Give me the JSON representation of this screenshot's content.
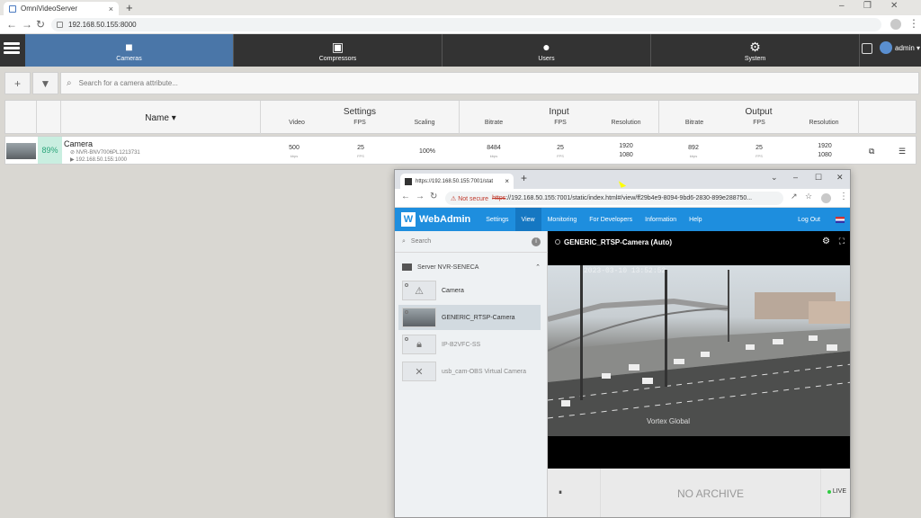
{
  "browser": {
    "tab_title": "OmniVideoServer",
    "tab_close": "×",
    "new_tab": "+",
    "address": "192.168.50.155:8000",
    "min": "–",
    "max": "❐",
    "close": "✕",
    "back": "←",
    "forward": "→",
    "reload": "↻",
    "menu": "⋮"
  },
  "nav": {
    "tabs": [
      "Cameras",
      "Compressors",
      "Users",
      "System"
    ],
    "user": "admin ▾"
  },
  "toolbar": {
    "add": "+",
    "filter": "▼",
    "search_placeholder": "Search for a camera attribute..."
  },
  "table": {
    "name_header": "Name ▾",
    "groups": [
      "Settings",
      "Input",
      "Output"
    ],
    "settings_cols": [
      "Video",
      "FPS",
      "Scaling"
    ],
    "input_cols": [
      "Bitrate",
      "FPS",
      "Resolution"
    ],
    "output_cols": [
      "Bitrate",
      "FPS",
      "Resolution"
    ],
    "row": {
      "health": "89%",
      "name": "Camera",
      "sub1": "NVR-BNV7006PL1213731",
      "sub2": "192.168.50.155:1000",
      "video": "500",
      "video_unit": "kbps",
      "fps": "25",
      "fps_unit": "FPS",
      "scaling": "100%",
      "in_bitrate": "8484",
      "in_bitrate_unit": "kbps",
      "in_fps": "25",
      "in_fps_unit": "FPS",
      "in_res_w": "1920",
      "in_res_h": "1080",
      "out_bitrate": "892",
      "out_bitrate_unit": "kbps",
      "out_fps": "25",
      "out_fps_unit": "FPS",
      "out_res_w": "1920",
      "out_res_h": "1080"
    }
  },
  "popup": {
    "tab_title": "https://192.168.50.155:7001/stat",
    "tab_close": "×",
    "new_tab": "+",
    "not_secure": "⚠ Not secure",
    "url_scheme": "https",
    "url_rest": "://192.168.50.155:7001/static/index.html#/view/ff29b4e9-8094-9bd6-2830-899e288750...",
    "min": "–",
    "max": "☐",
    "close": "✕",
    "chevron": "⌄",
    "brand": "WebAdmin",
    "menu": [
      "Settings",
      "View",
      "Monitoring",
      "For Developers",
      "Information",
      "Help"
    ],
    "logout": "Log Out",
    "search": "Search",
    "server": "Server NVR-SENECA",
    "cameras": [
      "Camera",
      "GENERIC_RTSP-Camera",
      "IP-B2VFC-SS",
      "usb_cam-OBS Virtual Camera"
    ],
    "view_title": "GENERIC_RTSP-Camera (Auto)",
    "timestamp": "2023-03-10 13:52:52",
    "watermark": "Vortex Global",
    "no_archive": "NO ARCHIVE",
    "live": "LIVE",
    "pause": "⏸"
  }
}
